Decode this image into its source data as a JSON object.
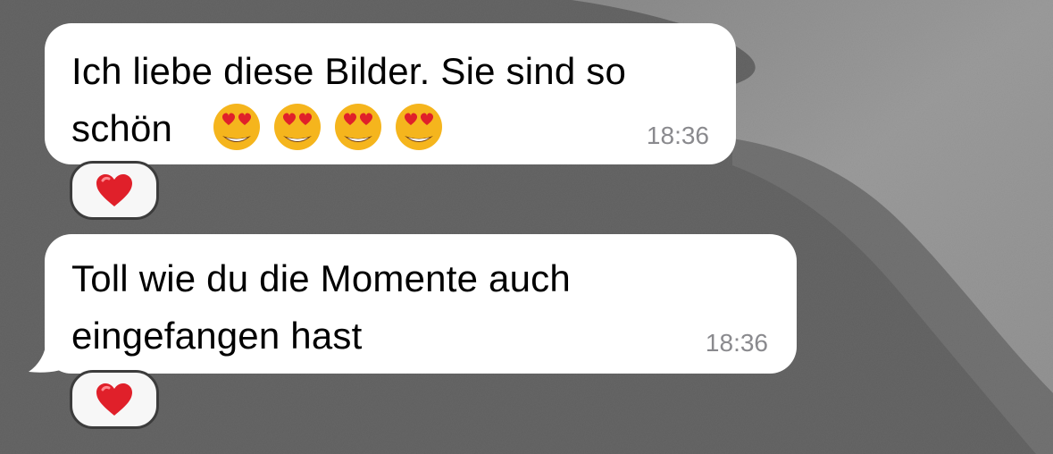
{
  "messages": [
    {
      "line1": "Ich liebe diese Bilder. Sie sind so",
      "line2": "schön",
      "emojis": [
        "heart-eyes-emoji",
        "heart-eyes-emoji",
        "heart-eyes-emoji",
        "heart-eyes-emoji"
      ],
      "time": "18:36",
      "reaction": "heart-icon"
    },
    {
      "line1": "Toll wie du die Momente auch",
      "line2": "eingefangen hast",
      "time": "18:36",
      "reaction": "heart-icon"
    }
  ],
  "colors": {
    "bubble": "#ffffff",
    "time": "#8a8a8e",
    "heart": "#e0202a",
    "wallpaper_dark": "#3c3c3c",
    "wallpaper_light": "#a8a8a8"
  }
}
